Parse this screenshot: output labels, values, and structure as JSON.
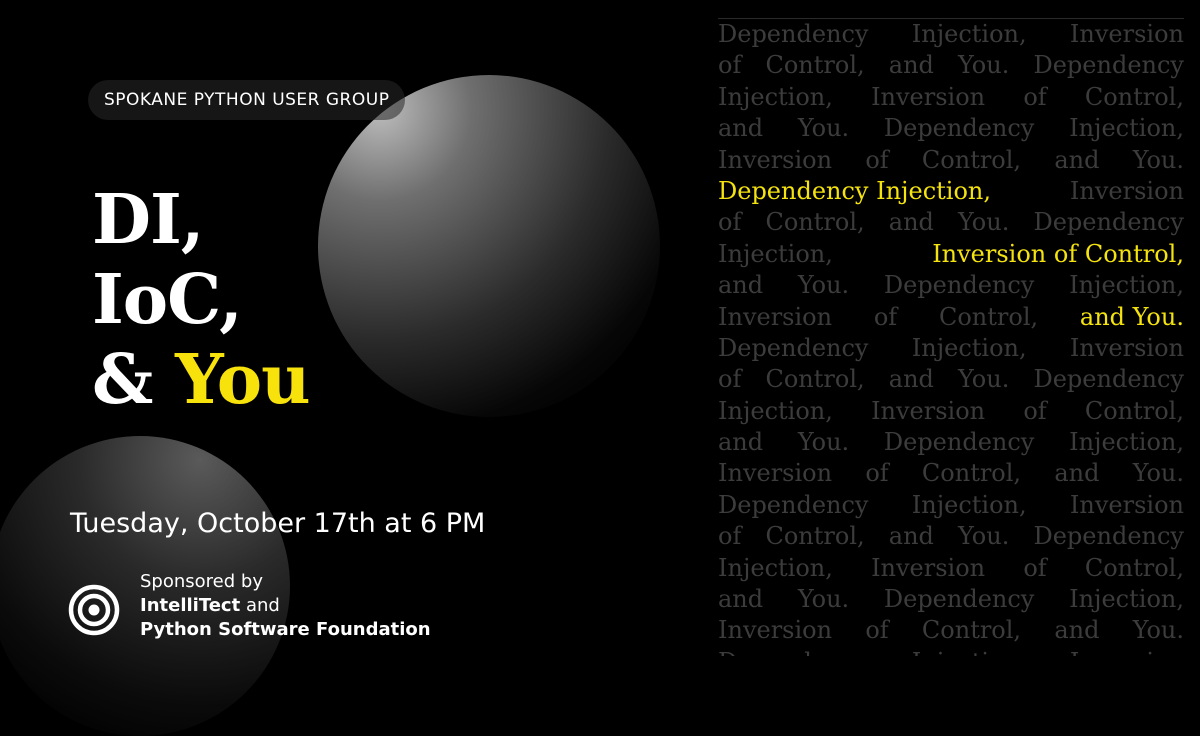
{
  "header": {
    "group": "SPOKANE PYTHON USER GROUP"
  },
  "headline": {
    "line1": "DI,",
    "line2": "IoC,",
    "line3_prefix": "&",
    "line3_accent": "You"
  },
  "event": {
    "date": "Tuesday, October 17th at 6 PM"
  },
  "sponsor": {
    "intro": "Sponsored by",
    "name1": "IntelliTect",
    "joiner": "and",
    "name2": "Python Software Foundation",
    "logo_icon": "intellitect-concentric-logo-icon"
  },
  "colors": {
    "accent": "#f7e20b",
    "background": "#000000",
    "pattern_text": "#3c3c3c"
  },
  "pattern_rows": [
    [
      {
        "t": "Dependency"
      },
      {
        "t": "Injection,"
      },
      {
        "t": "Inversion"
      }
    ],
    [
      {
        "t": "of"
      },
      {
        "t": "Control,"
      },
      {
        "t": "and"
      },
      {
        "t": "You."
      },
      {
        "t": "Dependency"
      }
    ],
    [
      {
        "t": "Injection,"
      },
      {
        "t": "Inversion"
      },
      {
        "t": "of"
      },
      {
        "t": "Control,"
      }
    ],
    [
      {
        "t": "and"
      },
      {
        "t": "You."
      },
      {
        "t": "Dependency"
      },
      {
        "t": "Injection,"
      }
    ],
    [
      {
        "t": "Inversion"
      },
      {
        "t": "of"
      },
      {
        "t": "Control,"
      },
      {
        "t": "and"
      },
      {
        "t": "You."
      }
    ],
    [
      {
        "t": "Dependency Injection,",
        "h": true
      },
      {
        "t": "Inversion"
      }
    ],
    [
      {
        "t": "of"
      },
      {
        "t": "Control,"
      },
      {
        "t": "and"
      },
      {
        "t": "You."
      },
      {
        "t": "Dependency"
      }
    ],
    [
      {
        "t": "Injection,"
      },
      {
        "t": "Inversion of Control,",
        "h": true
      }
    ],
    [
      {
        "t": "and"
      },
      {
        "t": "You."
      },
      {
        "t": "Dependency"
      },
      {
        "t": "Injection,"
      }
    ],
    [
      {
        "t": "Inversion"
      },
      {
        "t": "of"
      },
      {
        "t": "Control,"
      },
      {
        "t": "and You.",
        "h": true
      }
    ],
    [
      {
        "t": "Dependency"
      },
      {
        "t": "Injection,"
      },
      {
        "t": "Inversion"
      }
    ],
    [
      {
        "t": "of"
      },
      {
        "t": "Control,"
      },
      {
        "t": "and"
      },
      {
        "t": "You."
      },
      {
        "t": "Dependency"
      }
    ],
    [
      {
        "t": "Injection,"
      },
      {
        "t": "Inversion"
      },
      {
        "t": "of"
      },
      {
        "t": "Control,"
      }
    ],
    [
      {
        "t": "and"
      },
      {
        "t": "You."
      },
      {
        "t": "Dependency"
      },
      {
        "t": "Injection,"
      }
    ],
    [
      {
        "t": "Inversion"
      },
      {
        "t": "of"
      },
      {
        "t": "Control,"
      },
      {
        "t": "and"
      },
      {
        "t": "You."
      }
    ],
    [
      {
        "t": "Dependency"
      },
      {
        "t": "Injection,"
      },
      {
        "t": "Inversion"
      }
    ],
    [
      {
        "t": "of"
      },
      {
        "t": "Control,"
      },
      {
        "t": "and"
      },
      {
        "t": "You."
      },
      {
        "t": "Dependency"
      }
    ],
    [
      {
        "t": "Injection,"
      },
      {
        "t": "Inversion"
      },
      {
        "t": "of"
      },
      {
        "t": "Control,"
      }
    ],
    [
      {
        "t": "and"
      },
      {
        "t": "You."
      },
      {
        "t": "Dependency"
      },
      {
        "t": "Injection,"
      }
    ],
    [
      {
        "t": "Inversion"
      },
      {
        "t": "of"
      },
      {
        "t": "Control,"
      },
      {
        "t": "and"
      },
      {
        "t": "You."
      }
    ],
    [
      {
        "t": "Dependency"
      },
      {
        "t": "Injection,"
      },
      {
        "t": "Inversion"
      }
    ]
  ]
}
